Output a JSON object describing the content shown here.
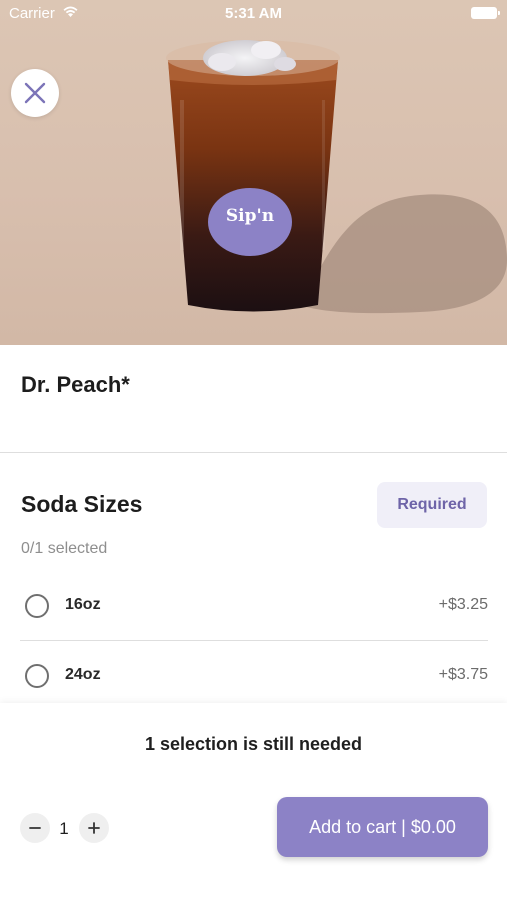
{
  "status_bar": {
    "carrier": "Carrier",
    "time": "5:31 AM"
  },
  "product": {
    "name": "Dr. Peach*",
    "cup_brand": "Sip'n"
  },
  "option_group": {
    "title": "Soda Sizes",
    "badge": "Required",
    "selected_count": "0/1 selected",
    "options": [
      {
        "name": "16oz",
        "price": "+$3.25",
        "selected": false
      },
      {
        "name": "24oz",
        "price": "+$3.75",
        "selected": false
      }
    ]
  },
  "footer": {
    "notice": "1 selection is still needed",
    "quantity": "1",
    "add_to_cart": "Add to cart | $0.00"
  },
  "colors": {
    "accent": "#8c82c6",
    "badge_bg": "#f0eff8",
    "badge_text": "#6e64a8"
  },
  "icons": [
    "wifi-icon",
    "battery-icon",
    "close-icon",
    "minus-icon",
    "plus-icon"
  ]
}
